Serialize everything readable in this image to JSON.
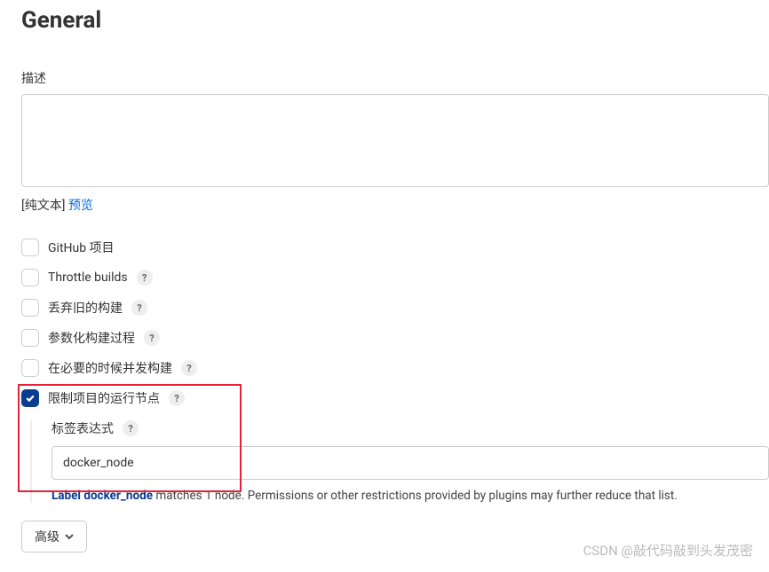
{
  "section_title": "General",
  "description": {
    "label": "描述",
    "value": "",
    "plain_text": "[纯文本]",
    "preview": "预览"
  },
  "options": {
    "github_project": {
      "label": "GitHub 项目",
      "checked": false,
      "help": false
    },
    "throttle_builds": {
      "label": "Throttle builds",
      "checked": false,
      "help": true
    },
    "discard_old": {
      "label": "丢弃旧的构建",
      "checked": false,
      "help": true
    },
    "parameterized": {
      "label": "参数化构建过程",
      "checked": false,
      "help": true
    },
    "concurrent": {
      "label": "在必要的时候并发构建",
      "checked": false,
      "help": true
    },
    "restrict_node": {
      "label": "限制项目的运行节点",
      "checked": true,
      "help": true
    }
  },
  "label_expression": {
    "label": "标签表达式",
    "value": "docker_node",
    "match_prefix": "Label docker_node",
    "match_suffix": " matches 1 node. Permissions or other restrictions provided by plugins may further reduce that list."
  },
  "advanced_btn": "高级",
  "watermark": "CSDN @敲代码敲到头发茂密"
}
